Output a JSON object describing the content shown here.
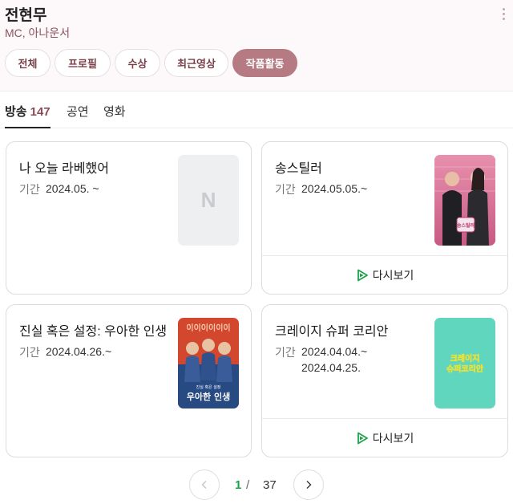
{
  "header": {
    "name": "전현무",
    "role": "MC, 아나운서"
  },
  "chips": [
    {
      "label": "전체",
      "active": false
    },
    {
      "label": "프로필",
      "active": false
    },
    {
      "label": "수상",
      "active": false
    },
    {
      "label": "최근영상",
      "active": false
    },
    {
      "label": "작품활동",
      "active": true
    }
  ],
  "tabs": [
    {
      "label": "방송",
      "count": "147",
      "active": true
    },
    {
      "label": "공연",
      "active": false
    },
    {
      "label": "영화",
      "active": false
    }
  ],
  "cards": [
    {
      "title": "나 오늘 라베했어",
      "period_label": "기간",
      "period": "2024.05. ~",
      "poster": "placeholder",
      "poster_letter": "N"
    },
    {
      "title": "송스틸러",
      "period_label": "기간",
      "period": "2024.05.05.~",
      "poster": "songstealer",
      "poster_caption": "송스틸러",
      "replay_label": "다시보기"
    },
    {
      "title": "진실 혹은 설정: 우아한 인생",
      "period_label": "기간",
      "period": "2024.04.26.~",
      "poster": "truth",
      "poster_top": "이이이이이이",
      "poster_small": "진실 혹은 설정",
      "poster_caption": "우아한 인생"
    },
    {
      "title": "크레이지 슈퍼 코리안",
      "period_label": "기간",
      "period": "2024.04.04.~",
      "period_end": "2024.04.25.",
      "poster": "crazy",
      "poster_caption_1": "크레이지",
      "poster_caption_2": "슈퍼코리안",
      "replay_label": "다시보기"
    }
  ],
  "pagination": {
    "current": "1",
    "separator": "/",
    "total": "37"
  },
  "colors": {
    "accent": "#b57a82",
    "brand_green": "#1aa34a",
    "header_bg": "#fdf8f9"
  }
}
